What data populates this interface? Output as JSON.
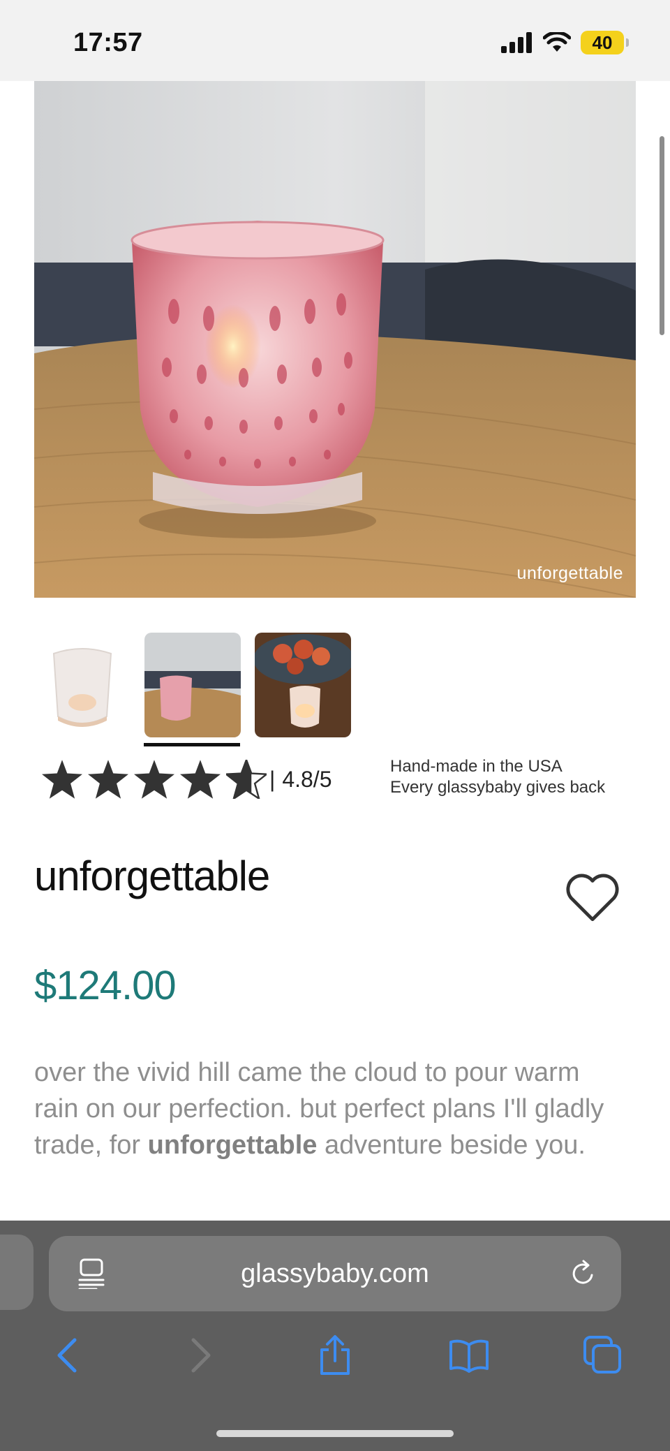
{
  "status_bar": {
    "time": "17:57",
    "battery": "40",
    "battery_color": "#f4d11c"
  },
  "hero": {
    "caption": "unforgettable"
  },
  "thumbnails": [
    {
      "name": "white glass candle",
      "selected": false
    },
    {
      "name": "pink glass on table",
      "selected": true
    },
    {
      "name": "glass with peaches",
      "selected": false
    }
  ],
  "rating": {
    "score": "4.8/5",
    "separator": "|",
    "stars_value": 4.8,
    "stars_max": 5
  },
  "badges": {
    "line1": "Hand-made in the USA",
    "line2": "Every glassybaby gives back"
  },
  "product": {
    "title": "unforgettable",
    "price": "$124.00",
    "price_color": "#1e7a78",
    "description_before": "over the vivid hill came the cloud to pour warm rain on our perfection. but perfect plans I'll gladly trade, for ",
    "description_bold": "unforgettable",
    "description_after": " adventure beside you."
  },
  "browser": {
    "url": "glassybaby.com",
    "icons": {
      "reader": "reader-icon",
      "reload": "reload-icon",
      "back": "chevron-left-icon",
      "forward": "chevron-right-icon",
      "share": "share-icon",
      "bookmarks": "book-icon",
      "tabs": "tabs-icon"
    },
    "accent": "#3d8cf0"
  }
}
